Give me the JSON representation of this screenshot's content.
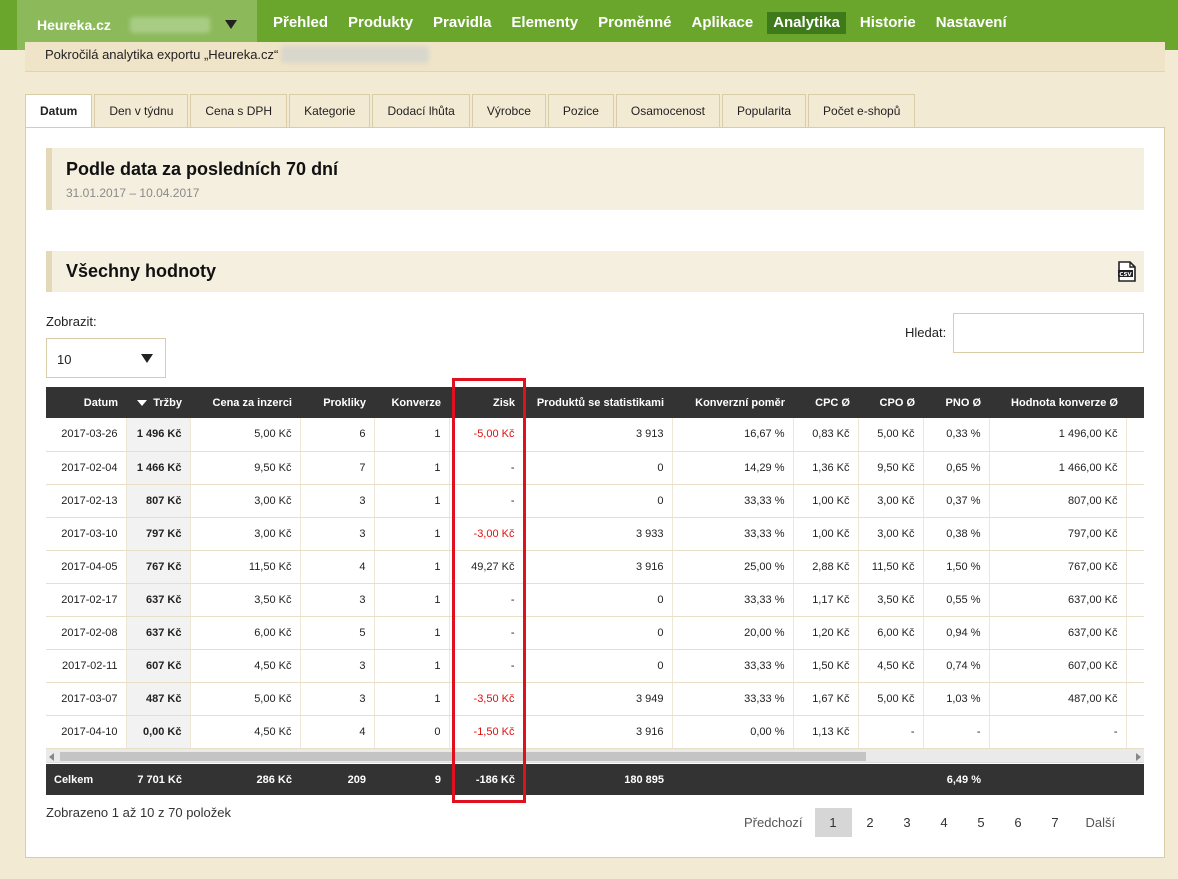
{
  "header": {
    "brand": "Heureka.cz",
    "nav": [
      "Přehled",
      "Produkty",
      "Pravidla",
      "Elementy",
      "Proměnné",
      "Aplikace",
      "Analytika",
      "Historie",
      "Nastavení"
    ],
    "active_nav": "Analytika",
    "subtitle": "Pokročilá analytika exportu „Heureka.cz“"
  },
  "tabs": [
    "Datum",
    "Den v týdnu",
    "Cena s DPH",
    "Kategorie",
    "Dodací lhůta",
    "Výrobce",
    "Pozice",
    "Osamocenost",
    "Popularita",
    "Počet e-shopů"
  ],
  "active_tab": "Datum",
  "period": {
    "title": "Podle data za posledních 70 dní",
    "range": "31.01.2017 – 10.04.2017"
  },
  "section": {
    "title": "Všechny hodnoty",
    "icon": "csv-file-icon"
  },
  "controls": {
    "show_label": "Zobrazit:",
    "show_value": "10",
    "search_label": "Hledat:",
    "search_value": ""
  },
  "table": {
    "columns": [
      "Datum",
      "Tržby",
      "Cena za inzerci",
      "Prokliky",
      "Konverze",
      "Zisk",
      "Produktů se statistikami",
      "Konverzní poměr",
      "CPC Ø",
      "CPO Ø",
      "PNO Ø",
      "Hodnota konverze Ø"
    ],
    "rows": [
      [
        "2017-03-26",
        "1 496 Kč",
        "5,00 Kč",
        "6",
        "1",
        "-5,00 Kč",
        "3 913",
        "16,67 %",
        "0,83 Kč",
        "5,00 Kč",
        "0,33 %",
        "1 496,00 Kč"
      ],
      [
        "2017-02-04",
        "1 466 Kč",
        "9,50 Kč",
        "7",
        "1",
        "-",
        "0",
        "14,29 %",
        "1,36 Kč",
        "9,50 Kč",
        "0,65 %",
        "1 466,00 Kč"
      ],
      [
        "2017-02-13",
        "807 Kč",
        "3,00 Kč",
        "3",
        "1",
        "-",
        "0",
        "33,33 %",
        "1,00 Kč",
        "3,00 Kč",
        "0,37 %",
        "807,00 Kč"
      ],
      [
        "2017-03-10",
        "797 Kč",
        "3,00 Kč",
        "3",
        "1",
        "-3,00 Kč",
        "3 933",
        "33,33 %",
        "1,00 Kč",
        "3,00 Kč",
        "0,38 %",
        "797,00 Kč"
      ],
      [
        "2017-04-05",
        "767 Kč",
        "11,50 Kč",
        "4",
        "1",
        "49,27 Kč",
        "3 916",
        "25,00 %",
        "2,88 Kč",
        "11,50 Kč",
        "1,50 %",
        "767,00 Kč"
      ],
      [
        "2017-02-17",
        "637 Kč",
        "3,50 Kč",
        "3",
        "1",
        "-",
        "0",
        "33,33 %",
        "1,17 Kč",
        "3,50 Kč",
        "0,55 %",
        "637,00 Kč"
      ],
      [
        "2017-02-08",
        "637 Kč",
        "6,00 Kč",
        "5",
        "1",
        "-",
        "0",
        "20,00 %",
        "1,20 Kč",
        "6,00 Kč",
        "0,94 %",
        "637,00 Kč"
      ],
      [
        "2017-02-11",
        "607 Kč",
        "4,50 Kč",
        "3",
        "1",
        "-",
        "0",
        "33,33 %",
        "1,50 Kč",
        "4,50 Kč",
        "0,74 %",
        "607,00 Kč"
      ],
      [
        "2017-03-07",
        "487 Kč",
        "5,00 Kč",
        "3",
        "1",
        "-3,50 Kč",
        "3 949",
        "33,33 %",
        "1,67 Kč",
        "5,00 Kč",
        "1,03 %",
        "487,00 Kč"
      ],
      [
        "2017-04-10",
        "0,00 Kč",
        "4,50 Kč",
        "4",
        "0",
        "-1,50 Kč",
        "3 916",
        "0,00 %",
        "1,13 Kč",
        "-",
        "-",
        "-"
      ]
    ],
    "footer": [
      "Celkem",
      "7 701 Kč",
      "286 Kč",
      "209",
      "9",
      "-186 Kč",
      "180 895",
      "",
      "",
      "",
      "6,49 %",
      ""
    ]
  },
  "info": "Zobrazeno 1 až 10 z 70 položek",
  "pagination": {
    "prev": "Předchozí",
    "pages": [
      "1",
      "2",
      "3",
      "4",
      "5",
      "6",
      "7"
    ],
    "current": "1",
    "next": "Další"
  },
  "colors": {
    "nav_green": "#6aa62c",
    "nav_active": "#3f7a1a",
    "negative": "#dd1111",
    "highlight": "#e0101e"
  }
}
